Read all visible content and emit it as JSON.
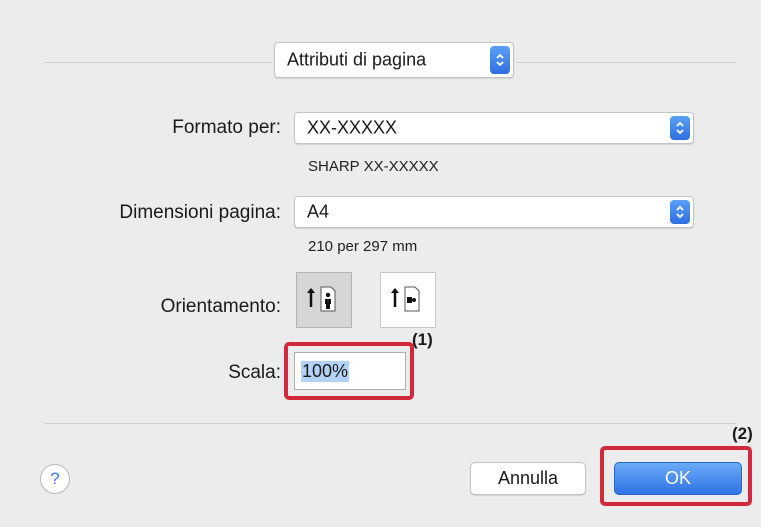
{
  "header": {
    "popup_label": "Attributi di pagina"
  },
  "form": {
    "format_label": "Formato per:",
    "format_value": "XX-XXXXX",
    "format_sub": "SHARP XX-XXXXX",
    "size_label": "Dimensioni pagina:",
    "size_value": "A4",
    "size_sub": "210 per 297 mm",
    "orientation_label": "Orientamento:",
    "orientation_options": [
      "portrait",
      "landscape"
    ],
    "orientation_selected": "portrait",
    "scale_label": "Scala:",
    "scale_value": "100%"
  },
  "callouts": {
    "scale": "(1)",
    "ok": "(2)"
  },
  "footer": {
    "help_label": "?",
    "cancel_label": "Annulla",
    "ok_label": "OK"
  },
  "colors": {
    "accent": "#2f73e6",
    "highlight": "#d22a3c",
    "background": "#ececec"
  }
}
